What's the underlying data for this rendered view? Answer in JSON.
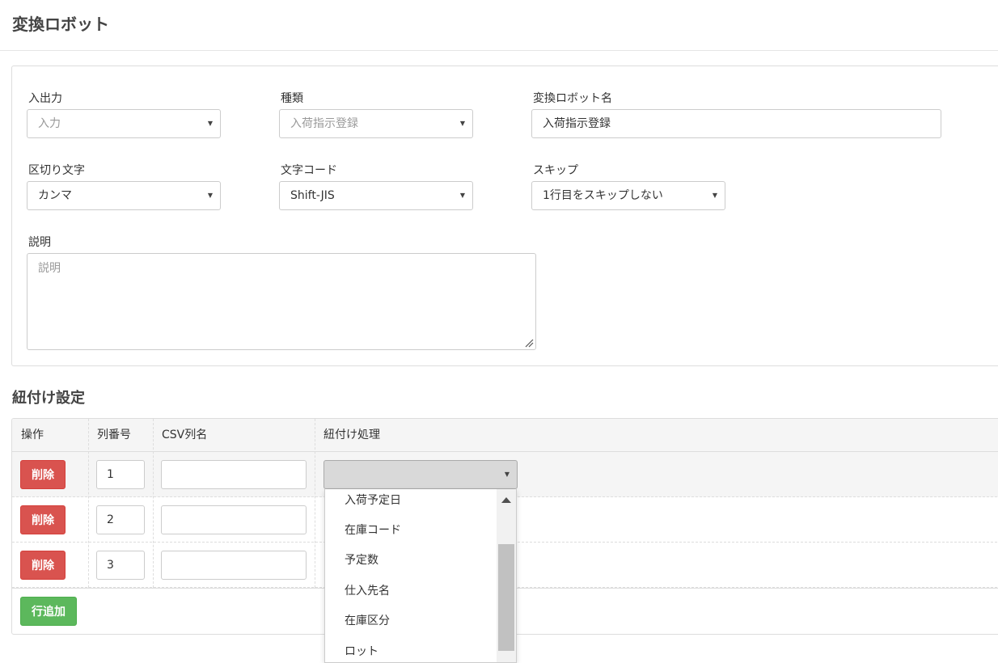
{
  "page": {
    "title": "変換ロボット"
  },
  "form": {
    "io": {
      "label": "入出力",
      "value": "入力"
    },
    "kind": {
      "label": "種類",
      "value": "入荷指示登録"
    },
    "robot_name": {
      "label": "変換ロボット名",
      "value": "入荷指示登録"
    },
    "delimiter": {
      "label": "区切り文字",
      "value": "カンマ"
    },
    "charset": {
      "label": "文字コード",
      "value": "Shift-JIS"
    },
    "skip": {
      "label": "スキップ",
      "value": "1行目をスキップしない"
    },
    "description": {
      "label": "説明",
      "placeholder": "説明"
    }
  },
  "mapping": {
    "title": "紐付け設定",
    "headers": {
      "op": "操作",
      "col_no": "列番号",
      "csv_name": "CSV列名",
      "process": "紐付け処理"
    },
    "rows": [
      {
        "delete_label": "削除",
        "col_no": "1",
        "csv_name": ""
      },
      {
        "delete_label": "削除",
        "col_no": "2",
        "csv_name": ""
      },
      {
        "delete_label": "削除",
        "col_no": "3",
        "csv_name": ""
      }
    ],
    "add_label": "行追加"
  },
  "dropdown": {
    "options": [
      "入荷予定日",
      "在庫コード",
      "予定数",
      "仕入先名",
      "在庫区分",
      "ロット"
    ]
  },
  "icons": {
    "caret": "caret-down-icon",
    "resize": "resize-handle-icon",
    "scroll_up": "scroll-up-arrow-icon"
  },
  "colors": {
    "danger": "#d9534f",
    "success": "#5cb85c"
  }
}
